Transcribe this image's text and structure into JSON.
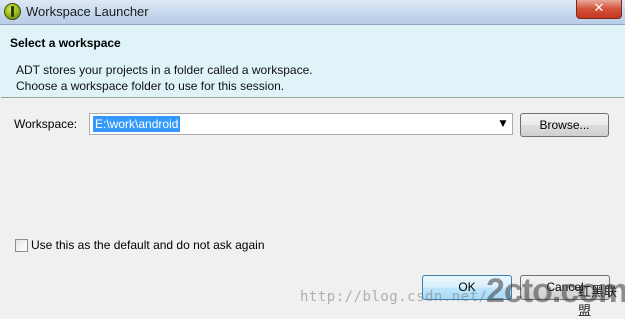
{
  "window": {
    "title": "Workspace Launcher",
    "close_glyph": "✕"
  },
  "header": {
    "title": "Select a workspace",
    "desc_line1": "ADT stores your projects in a folder called a workspace.",
    "desc_line2": "Choose a workspace folder to use for this session."
  },
  "workspace": {
    "label": "Workspace:",
    "value": "E:\\work\\android",
    "browse_label": "Browse..."
  },
  "default_option": {
    "label": "Use this as the default and do not ask again",
    "checked": false
  },
  "buttons": {
    "ok_label": "OK",
    "cancel_label": "Cancel"
  },
  "watermark": {
    "url_text": "http://blog.csdn.net/",
    "logo_text": "2cto.com",
    "logo_tail": "红黑联盟"
  },
  "colors": {
    "header_bg": "#dff3f8",
    "selection": "#3399ff",
    "close_red": "#c53720"
  }
}
